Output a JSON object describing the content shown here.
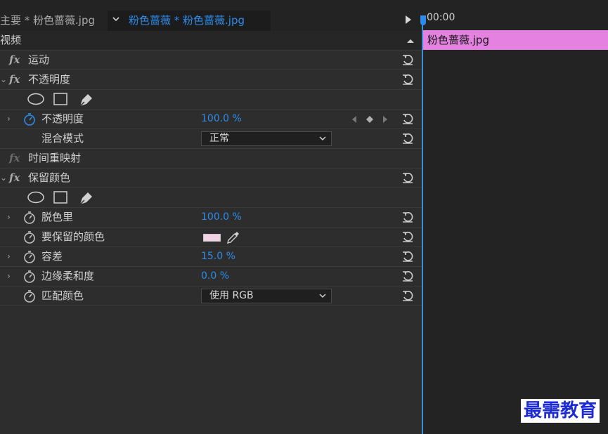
{
  "tabs": {
    "main_tab_label": "主要 * 粉色蔷薇.jpg",
    "active_tab_label": "粉色蔷薇 * 粉色蔷薇.jpg"
  },
  "section": {
    "title": "视频"
  },
  "effects": {
    "motion": {
      "fx": "fx",
      "label": "运动"
    },
    "opacity": {
      "fx": "fx",
      "label": "不透明度",
      "param_opacity": {
        "label": "不透明度",
        "value": "100.0 %"
      },
      "param_blend": {
        "label": "混合模式",
        "value": "正常"
      }
    },
    "time_remap": {
      "fx": "fx",
      "label": "时间重映射"
    },
    "leave_color": {
      "fx": "fx",
      "label": "保留颜色",
      "amount": {
        "label": "脱色里",
        "value": "100.0 %"
      },
      "color": {
        "label": "要保留的颜色",
        "swatch": "#f4d2e6"
      },
      "tolerance": {
        "label": "容差",
        "value": "15.0 %"
      },
      "edge": {
        "label": "边缘柔和度",
        "value": "0.0 %"
      },
      "match": {
        "label": "匹配颜色",
        "value": "使用 RGB"
      }
    }
  },
  "timeline": {
    "timecode": "00:00",
    "clip_label": "粉色蔷薇.jpg",
    "clip_color": "#e581e0"
  },
  "watermark": "最需教育",
  "colors": {
    "accent": "#2d8ceb",
    "panel": "#2d2d2d"
  }
}
